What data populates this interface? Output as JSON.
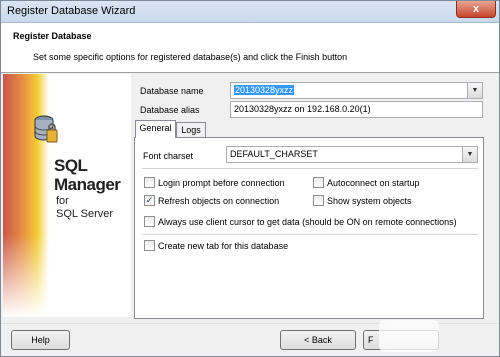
{
  "window": {
    "title": "Register Database Wizard",
    "close_glyph": "x"
  },
  "header": {
    "title": "Register Database",
    "subtitle": "Set some specific options for registered database(s) and click the Finish button"
  },
  "banner": {
    "line1": "SQL",
    "line2": "Manager",
    "line3": "for",
    "line4": "SQL Server",
    "icon": "database-icon"
  },
  "form": {
    "db_name_label": "Database name",
    "db_name_value": "20130328yxzz",
    "db_alias_label": "Database alias",
    "db_alias_value": "20130328yxzz on 192.168.0.20(1)"
  },
  "tabs": [
    {
      "label": "General",
      "active": true
    },
    {
      "label": "Logs",
      "active": false
    }
  ],
  "general": {
    "font_charset_label": "Font charset",
    "font_charset_value": "DEFAULT_CHARSET",
    "options": [
      {
        "label": "Login prompt before connection",
        "checked": false
      },
      {
        "label": "Autoconnect on startup",
        "checked": false
      },
      {
        "label": "Refresh objects on connection",
        "checked": true
      },
      {
        "label": "Show system objects",
        "checked": false
      },
      {
        "label": "Always use client cursor to get data (should be ON on remote connections)",
        "checked": false
      },
      {
        "label": "Create new tab for this database",
        "checked": false
      }
    ]
  },
  "buttons": {
    "help": "Help",
    "back": "< Back",
    "finish": "F"
  },
  "watermark": "",
  "colors": {
    "selection": "#3399ff",
    "close": "#c7452c"
  }
}
